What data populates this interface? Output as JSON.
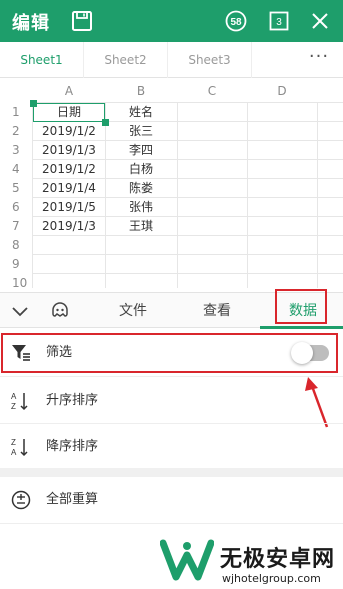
{
  "topbar": {
    "title": "编辑",
    "badge_count": "58",
    "page_count": "3",
    "bg_color": "#1e9e6b"
  },
  "sheets": {
    "tabs": [
      "Sheet1",
      "Sheet2",
      "Sheet3"
    ],
    "active_index": 0,
    "more_label": "···"
  },
  "grid": {
    "columns": [
      "A",
      "B",
      "C",
      "D"
    ],
    "row_numbers": [
      "1",
      "2",
      "3",
      "4",
      "5",
      "6",
      "7",
      "8",
      "9",
      "10"
    ],
    "rows": [
      [
        "日期",
        "姓名"
      ],
      [
        "2019/1/2",
        "张三"
      ],
      [
        "2019/1/3",
        "李四"
      ],
      [
        "2019/1/2",
        "白杨"
      ],
      [
        "2019/1/4",
        "陈娄"
      ],
      [
        "2019/1/5",
        "张伟"
      ],
      [
        "2019/1/3",
        "王琪"
      ]
    ],
    "selected_cell": "A1"
  },
  "toolbar": {
    "tabs": [
      "文件",
      "查看",
      "数据"
    ],
    "active_tab": "数据"
  },
  "panel": {
    "filter_label": "筛选",
    "filter_enabled": false,
    "sort_asc_label": "升序排序",
    "sort_desc_label": "降序排序",
    "recalc_label": "全部重算"
  },
  "watermark": {
    "title": "无极安卓网",
    "url": "wjhotelgroup.com"
  }
}
